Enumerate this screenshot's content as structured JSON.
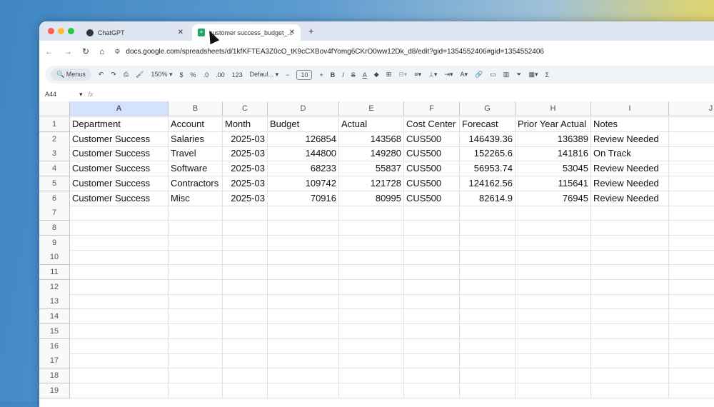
{
  "browser": {
    "tabs": [
      {
        "label": "ChatGPT",
        "icon": "chatgpt-icon"
      },
      {
        "label": "customer success_budget_...",
        "icon": "sheets-icon"
      }
    ],
    "url": "docs.google.com/spreadsheets/d/1kfKFTEA3Z0cO_tK9cCXBov4fYomg6CKrO0ww12Dk_d8/edit?gid=1354552406#gid=1354552406"
  },
  "toolbar": {
    "menus": "Menus",
    "zoom": "150%",
    "currency": "$",
    "percent": "%",
    "dec_less": ".0",
    "dec_more": ".00",
    "format": "123",
    "font": "Defaul...",
    "font_size": "10",
    "bold": "B",
    "italic": "I",
    "sum": "Σ"
  },
  "formula_bar": {
    "cell_ref": "A44",
    "fx": "fx",
    "value": ""
  },
  "sheet": {
    "columns": [
      "A",
      "B",
      "C",
      "D",
      "E",
      "F",
      "G",
      "H",
      "I",
      "J"
    ],
    "rows": [
      [
        "Department",
        "Account",
        "Month",
        "Budget",
        "Actual",
        "Cost Center",
        "Forecast",
        "Prior Year Actual",
        "Notes",
        ""
      ],
      [
        "Customer Success",
        "Salaries",
        "2025-03",
        "126854",
        "143568",
        "CUS500",
        "146439.36",
        "136389",
        "Review Needed",
        ""
      ],
      [
        "Customer Success",
        "Travel",
        "2025-03",
        "144800",
        "149280",
        "CUS500",
        "152265.6",
        "141816",
        "On Track",
        ""
      ],
      [
        "Customer Success",
        "Software",
        "2025-03",
        "68233",
        "55837",
        "CUS500",
        "56953.74",
        "53045",
        "Review Needed",
        ""
      ],
      [
        "Customer Success",
        "Contractors",
        "2025-03",
        "109742",
        "121728",
        "CUS500",
        "124162.56",
        "115641",
        "Review Needed",
        ""
      ],
      [
        "Customer Success",
        "Misc",
        "2025-03",
        "70916",
        "80995",
        "CUS500",
        "82614.9",
        "76945",
        "Review Needed",
        ""
      ]
    ],
    "row_count": 19
  }
}
